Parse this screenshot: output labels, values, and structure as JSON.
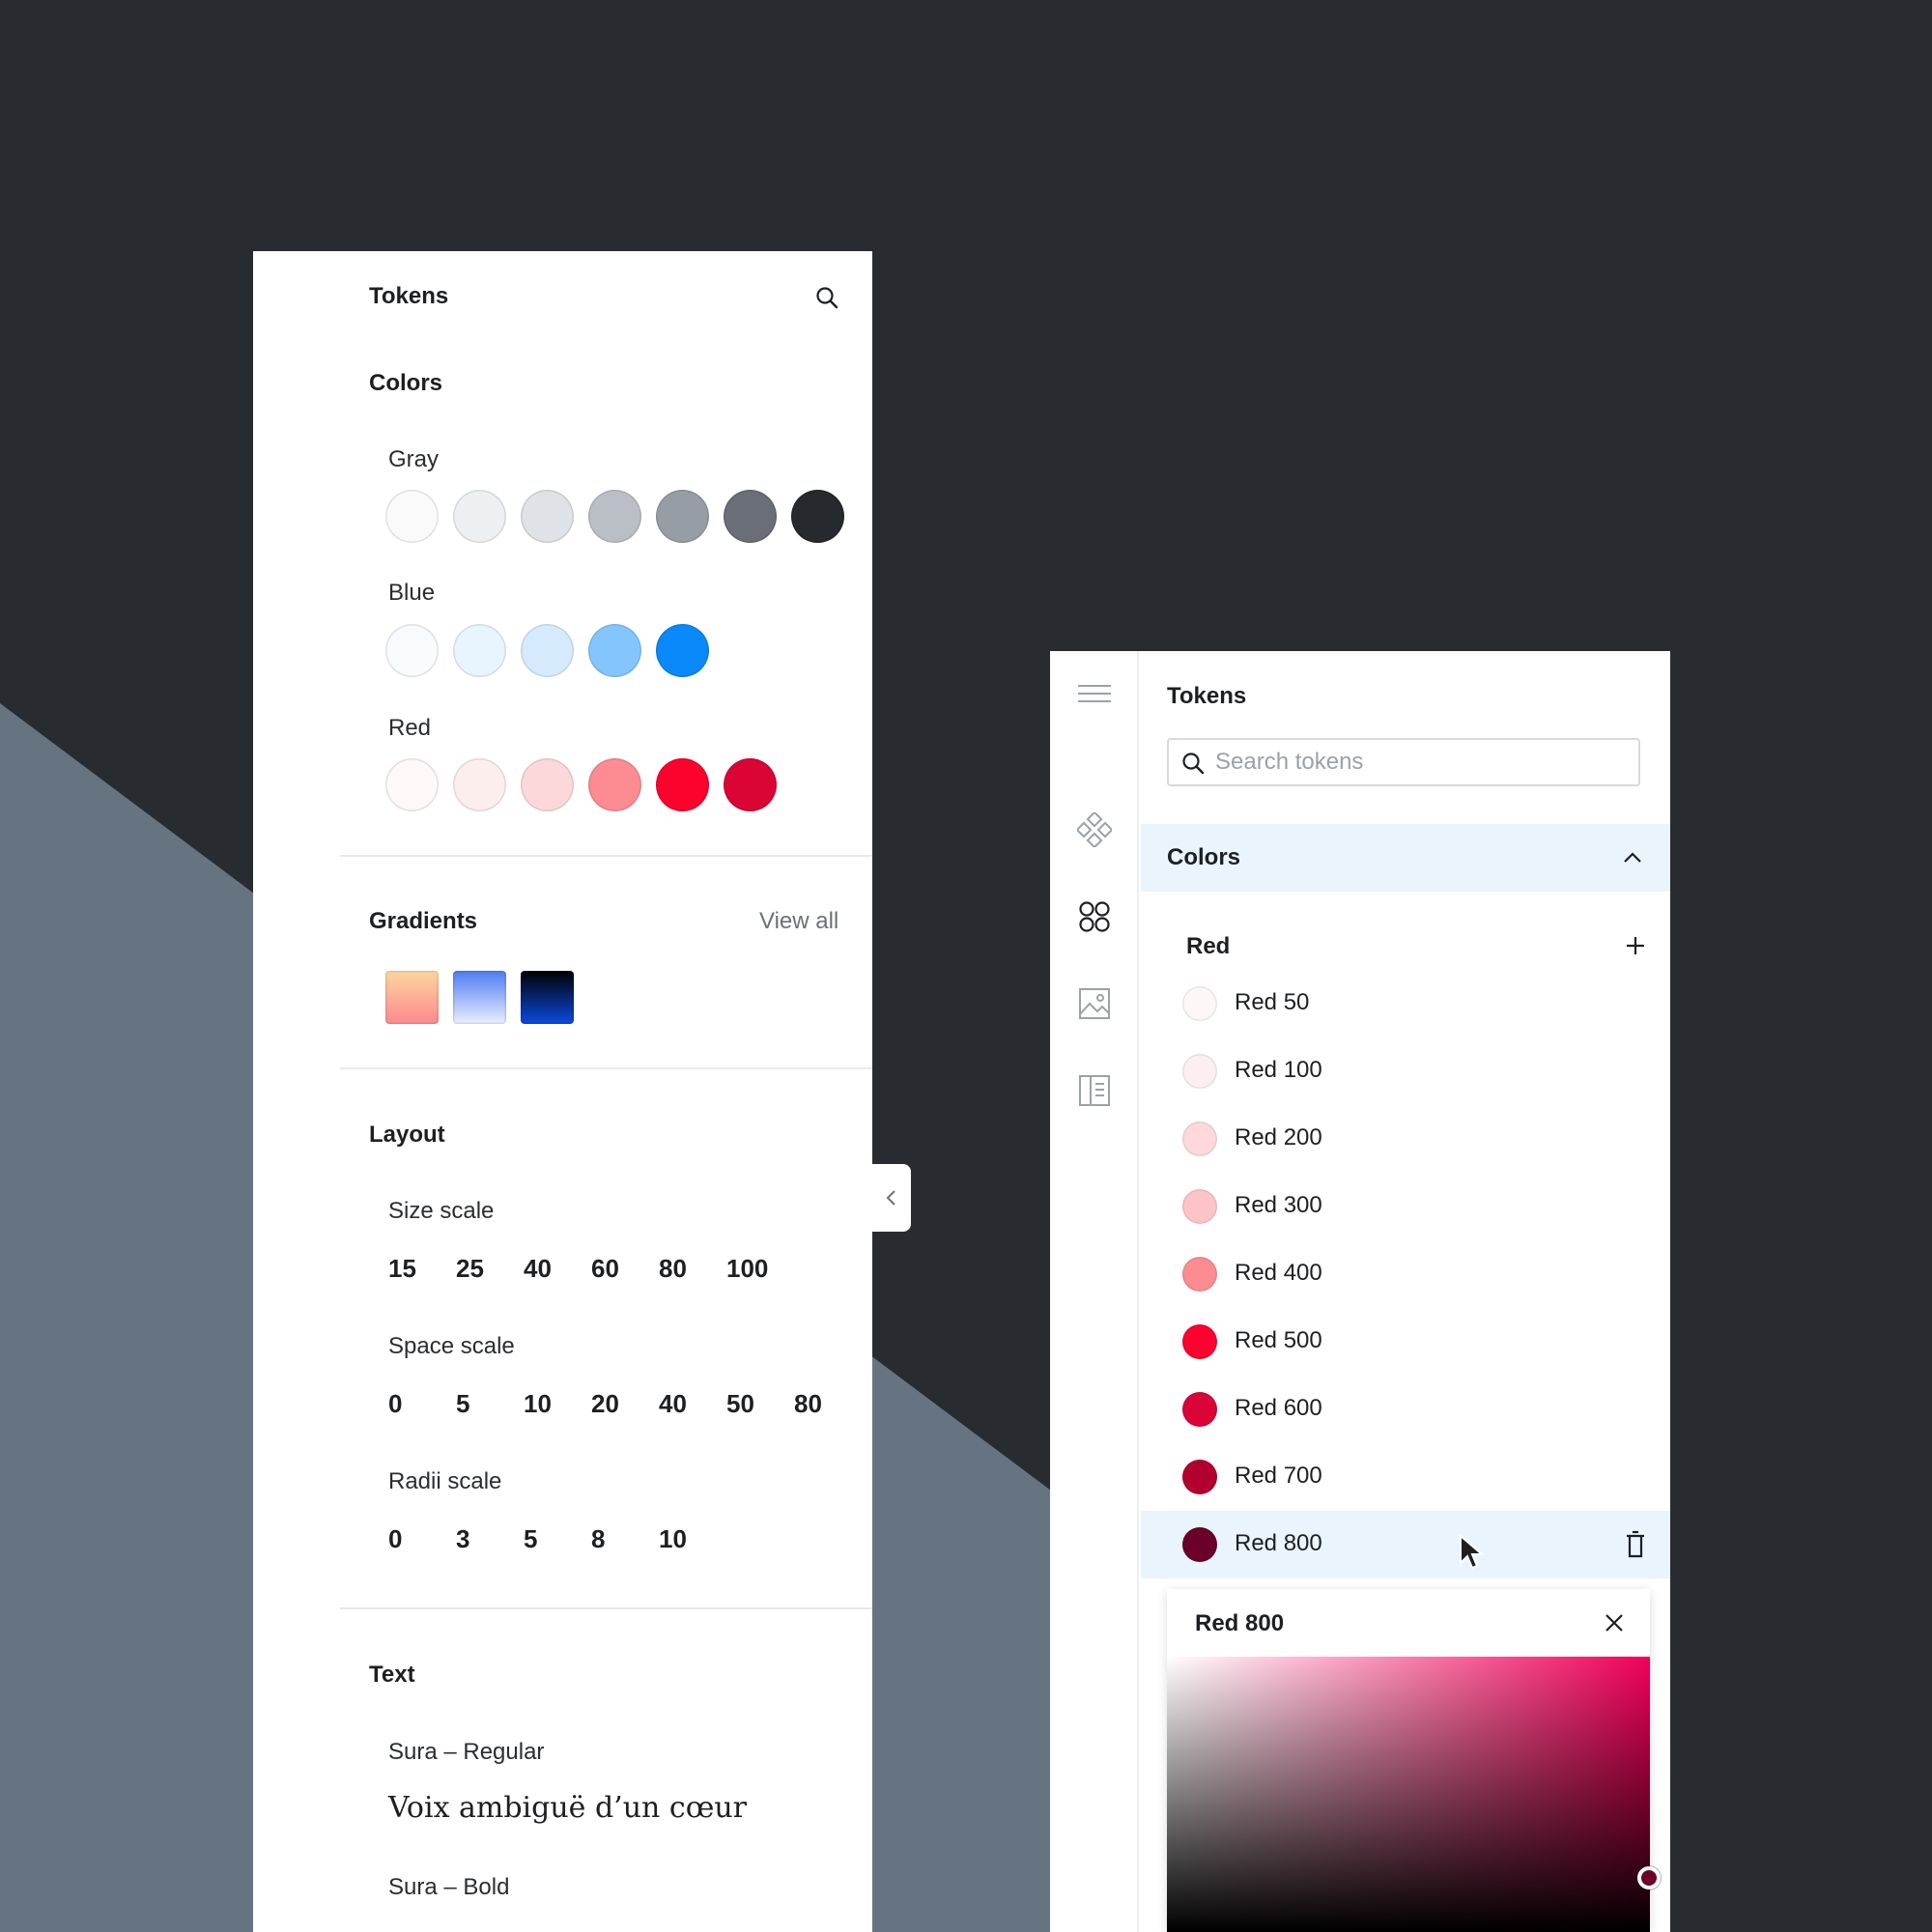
{
  "left_panel": {
    "title": "Tokens",
    "colors_title": "Colors",
    "gray_label": "Gray",
    "gray_swatches": [
      "#fafafa",
      "#edf0f2",
      "#dfe2e6",
      "#babfc6",
      "#979da5",
      "#6a6f77",
      "#26292d"
    ],
    "blue_label": "Blue",
    "blue_swatches": [
      "#f7fbfe",
      "#e9f5fe",
      "#d5ebfd",
      "#84c5fd",
      "#0a89fb"
    ],
    "red_label": "Red",
    "red_swatches": [
      "#fff8f8",
      "#fdeeee",
      "#fdd8da",
      "#fc8c92",
      "#fc032e",
      "#db0535"
    ],
    "gradients_title": "Gradients",
    "view_all": "View all",
    "gradients": [
      [
        "#fdd59e",
        "#fb8a8e"
      ],
      [
        "#4d7bf3",
        "#eaf0fd"
      ],
      [
        "#000000",
        "#0b4ae0"
      ]
    ],
    "layout_title": "Layout",
    "size_scale_label": "Size scale",
    "size_scale": [
      "15",
      "25",
      "40",
      "60",
      "80",
      "100"
    ],
    "space_scale_label": "Space scale",
    "space_scale": [
      "0",
      "5",
      "10",
      "20",
      "40",
      "50",
      "80"
    ],
    "radii_scale_label": "Radii scale",
    "radii_scale": [
      "0",
      "3",
      "5",
      "8",
      "10"
    ],
    "text_title": "Text",
    "font_regular_label": "Sura – Regular",
    "font_sample": "Voix ambiguë d’un cœur",
    "font_bold_label": "Sura – Bold"
  },
  "right_panel": {
    "title": "Tokens",
    "search_placeholder": "Search tokens",
    "colors_header": "Colors",
    "group_label": "Red",
    "items": [
      {
        "label": "Red 50",
        "color": "#fdf7f8"
      },
      {
        "label": "Red 100",
        "color": "#fdeff0"
      },
      {
        "label": "Red 200",
        "color": "#fdd9dc"
      },
      {
        "label": "Red 300",
        "color": "#fcc4c9"
      },
      {
        "label": "Red 400",
        "color": "#fb8c92"
      },
      {
        "label": "Red 500",
        "color": "#fb032e"
      },
      {
        "label": "Red 600",
        "color": "#da0536"
      },
      {
        "label": "Red 700",
        "color": "#b3012f"
      },
      {
        "label": "Red 800",
        "color": "#6b0028"
      }
    ],
    "selected_item": "Red 800",
    "picker_title": "Red 800"
  },
  "colors": {
    "background": "#282c31",
    "background_shape": "#667482",
    "selection": "#e9f4fd",
    "icon_gray": "#9aa1a9"
  },
  "icons": {
    "left_search": "search-icon",
    "collapse": "chevron-left-icon",
    "rail": [
      "menu-icon",
      "components-icon",
      "tokens-icon",
      "image-icon",
      "document-icon"
    ],
    "add": "plus-icon",
    "collapse_section": "chevron-up-icon",
    "delete": "trash-icon",
    "close": "close-icon"
  }
}
